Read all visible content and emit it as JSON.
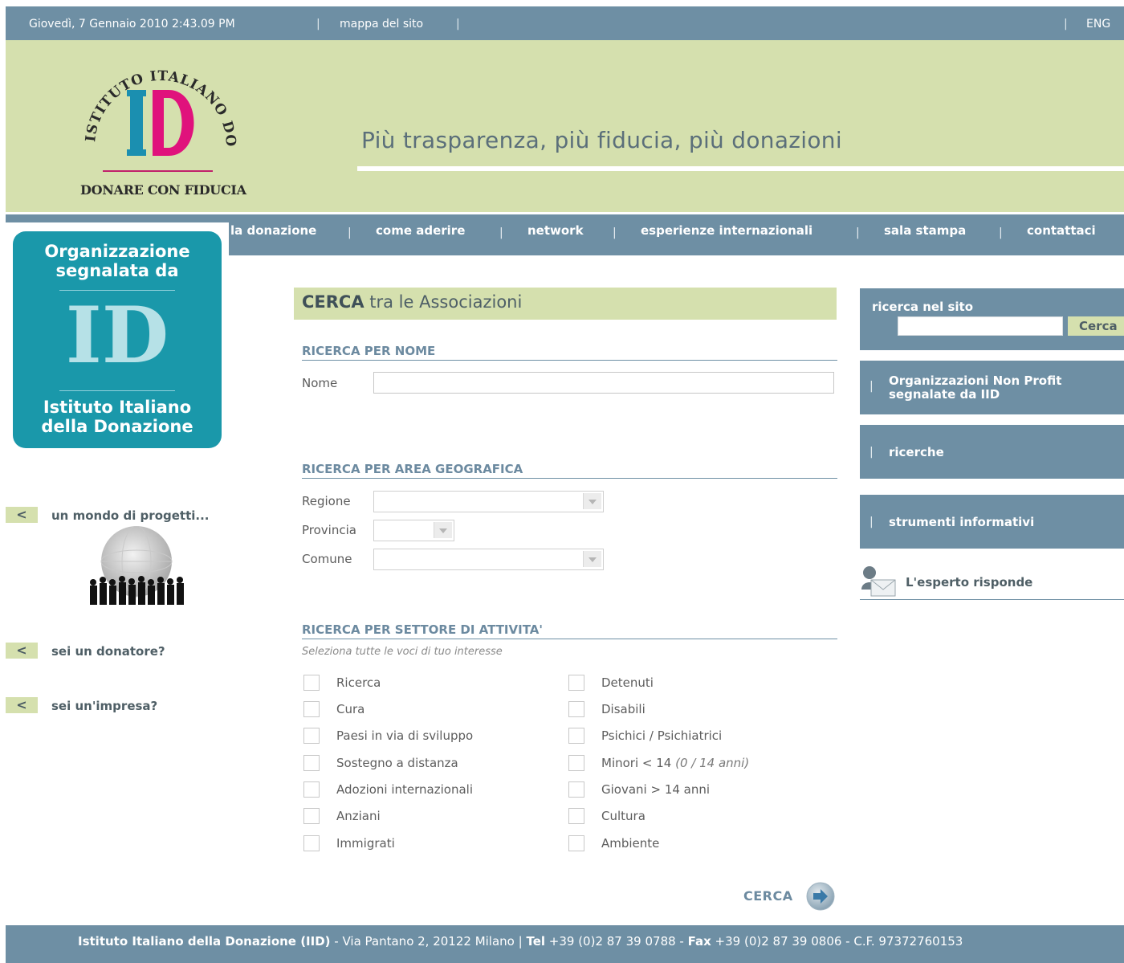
{
  "topbar": {
    "datetime": "Giovedì, 7 Gennaio 2010 2:43.09 PM",
    "sitemap": "mappa del sito",
    "language": "ENG"
  },
  "header": {
    "logo_arc_text": "ISTITUTO ITALIANO DONAZIONE",
    "logo_letters": "ID",
    "logo_tagline": "DONARE CON FIDUCIA",
    "tagline": "Più trasparenza, più fiducia, più donazioni"
  },
  "nav": {
    "items": [
      {
        "label": "la donazione"
      },
      {
        "label": "come aderire"
      },
      {
        "label": "network"
      },
      {
        "label": "esperienze internazionali"
      },
      {
        "label": "sala stampa"
      },
      {
        "label": "contattaci"
      }
    ]
  },
  "badge": {
    "top_line1": "Organizzazione",
    "top_line2": "segnalata da",
    "letters": "ID",
    "bottom_line1": "Istituto Italiano",
    "bottom_line2": "della Donazione"
  },
  "left_links": {
    "arrow": "<",
    "projects": "un mondo di progetti...",
    "donor": "sei un donatore?",
    "company": "sei un'impresa?"
  },
  "search": {
    "heading_bold": "CERCA",
    "heading_rest": " tra le Associazioni",
    "by_name": {
      "title": "RICERCA PER NOME",
      "name_label": "Nome",
      "name_value": ""
    },
    "by_area": {
      "title": "RICERCA PER AREA GEOGRAFICA",
      "region_label": "Regione",
      "province_label": "Provincia",
      "city_label": "Comune",
      "region_value": "",
      "province_value": "",
      "city_value": ""
    },
    "by_sector": {
      "title": "RICERCA PER SETTORE DI ATTIVITA'",
      "hint": "Seleziona tutte le voci di tuo interesse",
      "left": [
        "Ricerca",
        "Cura",
        "Paesi in via di sviluppo",
        "Sostegno a distanza",
        "Adozioni internazionali",
        "Anziani",
        "Immigrati"
      ],
      "right": [
        "Detenuti",
        "Disabili",
        "Psichici / Psichiatrici",
        "Minori < 14",
        "Giovani > 14 anni",
        "Cultura",
        "Ambiente"
      ],
      "right_note": "(0 / 14 anni)"
    },
    "submit": "CERCA"
  },
  "sidebar": {
    "site_search_label": "ricerca nel sito",
    "site_search_value": "",
    "site_search_button": "Cerca",
    "separator": "|",
    "nonprofit_line1": "Organizzazioni Non Profit",
    "nonprofit_line2": "segnalate da IID",
    "research": "ricerche",
    "tools": "strumenti informativi",
    "expert": "L'esperto risponde"
  },
  "footer": {
    "org": "Istituto Italiano della Donazione (IID)",
    "address": " - Via Pantano 2, 20122 Milano | ",
    "tel_label": "Tel",
    "tel": " +39 (0)2 87 39 0788 - ",
    "fax_label": "Fax",
    "fax": " +39 (0)2 87 39 0806 - C.F. 97372760153"
  },
  "colors": {
    "slate_blue": "#6e8fa4",
    "olive_light": "#d5e0ae",
    "teal_badge": "#1a98aa",
    "magenta": "#e0127c"
  }
}
